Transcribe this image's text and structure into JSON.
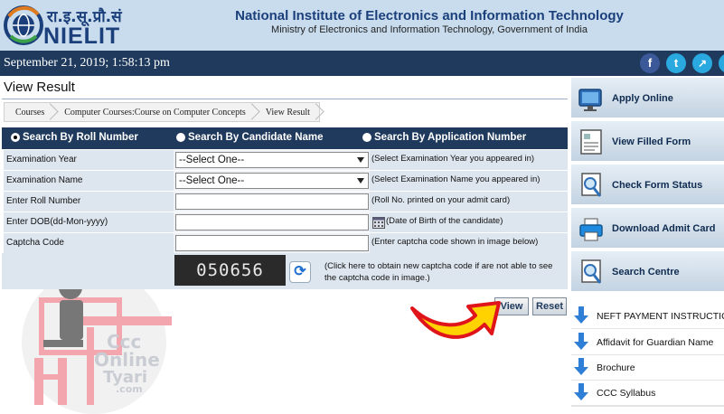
{
  "header": {
    "logo_hindi": "रा.इ.सू.प्रौ.सं",
    "logo_name": "NIELIT",
    "title": "National Institute of Electronics and Information Technology",
    "subtitle": "Ministry of Electronics and Information Technology, Government of India"
  },
  "datebar": {
    "datetime": "September 21, 2019; 1:58:13 pm",
    "social": [
      {
        "icon": "facebook-icon",
        "glyph": "f",
        "color": "#3b5998"
      },
      {
        "icon": "twitter-icon",
        "glyph": "t",
        "color": "#2aa9e0"
      },
      {
        "icon": "analytics-icon",
        "glyph": "↗",
        "color": "#2aa9e0"
      }
    ]
  },
  "main": {
    "page_title": "View Result",
    "breadcrumb": [
      "Courses",
      "Computer Courses:Course on Computer Concepts",
      "View Result"
    ],
    "search_options": [
      {
        "label": "Search By Roll Number",
        "selected": true
      },
      {
        "label": "Search By Candidate Name",
        "selected": false
      },
      {
        "label": "Search By Application Number",
        "selected": false
      }
    ],
    "fields": [
      {
        "label": "Examination Year",
        "value": "--Select One--",
        "hint": "(Select Examination Year you appeared in)"
      },
      {
        "label": "Examination Name",
        "value": "--Select One--",
        "hint": "(Select Examination Name you appeared in)"
      },
      {
        "label": "Enter Roll Number",
        "value": "",
        "hint": "(Roll No. printed on your admit card)"
      },
      {
        "label": "Enter DOB(dd-Mon-yyyy)",
        "value": "",
        "hint": "(Date of Birth of the candidate)"
      },
      {
        "label": "Captcha Code",
        "value": "",
        "hint": "(Enter captcha code shown in image below)"
      }
    ],
    "captcha_text": "050656",
    "captcha_hint": "(Click here to obtain new captcha code if are not able to see the captcha code in image.)",
    "view_button": "View",
    "reset_button": "Reset"
  },
  "sidebar": {
    "buttons": [
      {
        "label": "Apply Online",
        "icon": "monitor-icon"
      },
      {
        "label": "View Filled Form",
        "icon": "form-icon"
      },
      {
        "label": "Check Form Status",
        "icon": "magnifier-icon"
      },
      {
        "label": "Download Admit Card",
        "icon": "printer-icon"
      },
      {
        "label": "Search Centre",
        "icon": "magnifier-icon"
      }
    ],
    "links": [
      {
        "label": "NEFT PAYMENT INSTRUCTIONS",
        "icon": "download-arrow-icon"
      },
      {
        "label": "Affidavit for Guardian Name",
        "icon": "download-arrow-icon"
      },
      {
        "label": "Brochure",
        "icon": "download-arrow-icon"
      },
      {
        "label": "CCC Syllabus",
        "icon": "download-arrow-icon"
      }
    ]
  },
  "watermark": {
    "line1": "Ccc",
    "line2": "Online",
    "line3": "Tyari",
    "line4": ".com"
  },
  "colors": {
    "header_bg": "#c8dced",
    "navy": "#1f3a5c",
    "row_bg": "#dde5ee",
    "arrow_red": "#e0151b",
    "arrow_yellow": "#ffd200"
  }
}
